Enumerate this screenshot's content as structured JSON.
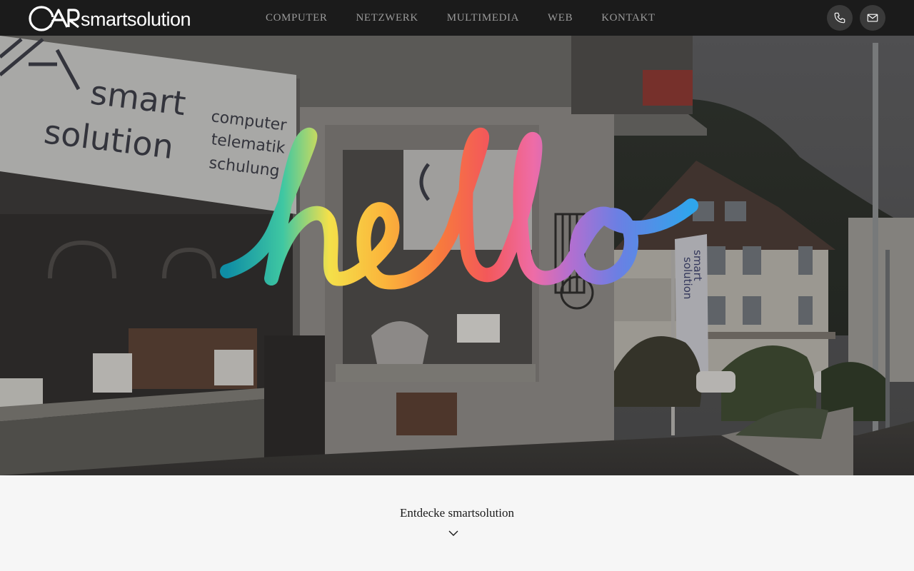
{
  "brand": {
    "logo_text": "smartsolution"
  },
  "nav": {
    "items": [
      "COMPUTER",
      "NETZWERK",
      "MULTIMEDIA",
      "WEB",
      "KONTAKT"
    ]
  },
  "header_actions": {
    "phone_icon": "phone-icon",
    "mail_icon": "mail-icon"
  },
  "hero": {
    "background_image": "storefront-photo",
    "storefront_sign": [
      "smart",
      "solution"
    ],
    "storefront_services": [
      "computer",
      "telematik",
      "schulung"
    ],
    "banner_text": [
      "smart",
      "solution"
    ],
    "overlay_word": "hello"
  },
  "discover": {
    "label": "Entdecke smartsolution",
    "icon": "chevron-down-icon"
  },
  "colors": {
    "header_bg": "#1b1b1b",
    "nav_text": "#9a9a9a",
    "icon_button_bg": "#3a3a3a",
    "section_bg": "#f6f6f6"
  }
}
